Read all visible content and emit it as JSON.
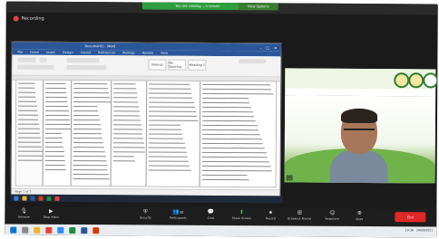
{
  "app": {
    "window_title": "Recording",
    "recording_label": "Recording"
  },
  "share": {
    "banner": "You are viewing ...'s screen",
    "view_options": "View Options"
  },
  "word": {
    "title": "Document1 - Word",
    "menu": [
      "File",
      "Home",
      "Insert",
      "Design",
      "Layout",
      "References",
      "Mailings",
      "Review",
      "View"
    ],
    "style1": "Normal",
    "style2": "No Spacing",
    "style3": "Heading 1",
    "status": "Page 1 of 3"
  },
  "video": {
    "participant_name": "..."
  },
  "controls": [
    {
      "icon": "mic-icon",
      "label": "Unmute"
    },
    {
      "icon": "video-icon",
      "label": "Stop Video"
    },
    {
      "icon": "shield-icon",
      "label": "Security"
    },
    {
      "icon": "participants-icon",
      "label": "Participants"
    },
    {
      "icon": "chat-icon",
      "label": "Chat"
    },
    {
      "icon": "share-icon",
      "label": "Share Screen"
    },
    {
      "icon": "record-icon",
      "label": "Record"
    },
    {
      "icon": "breakout-icon",
      "label": "Breakout Rooms"
    },
    {
      "icon": "reactions-icon",
      "label": "Reactions"
    },
    {
      "icon": "apps-icon",
      "label": "Apps"
    }
  ],
  "end_label": "End",
  "participants_count": "38",
  "taskbar": {
    "time": "10:36",
    "date": "24/09/2021"
  }
}
